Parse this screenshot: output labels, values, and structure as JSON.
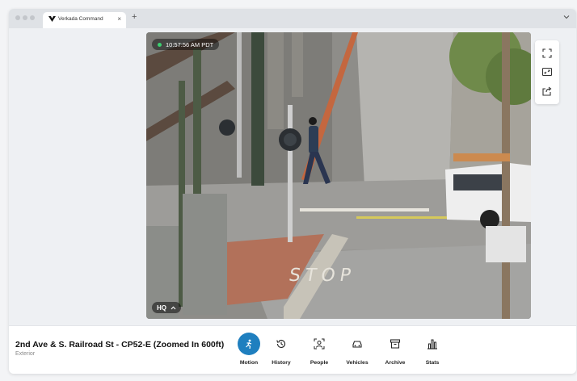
{
  "browser": {
    "tab_title": "Verkada Command",
    "tab_close": "×",
    "new_tab": "+"
  },
  "camera": {
    "timestamp": "10:57:56 AM PDT",
    "quality_label": "HQ",
    "scene_text": "STOP",
    "status_color": "#3cd070"
  },
  "side_tools": [
    "fullscreen-icon",
    "zoom-frame-icon",
    "share-icon"
  ],
  "footer": {
    "camera_name": "2nd Ave & S. Railroad St - CP52-E (Zoomed In 600ft)",
    "location": "Exterior",
    "accent_color": "#1f7fbf",
    "nav": [
      {
        "label": "Motion",
        "icon": "motion-icon",
        "active": true
      },
      {
        "label": "History",
        "icon": "history-icon",
        "active": false
      },
      {
        "label": "People",
        "icon": "people-icon",
        "active": false
      },
      {
        "label": "Vehicles",
        "icon": "vehicle-icon",
        "active": false
      },
      {
        "label": "Archive",
        "icon": "archive-icon",
        "active": false
      },
      {
        "label": "Stats",
        "icon": "stats-icon",
        "active": false
      }
    ]
  }
}
